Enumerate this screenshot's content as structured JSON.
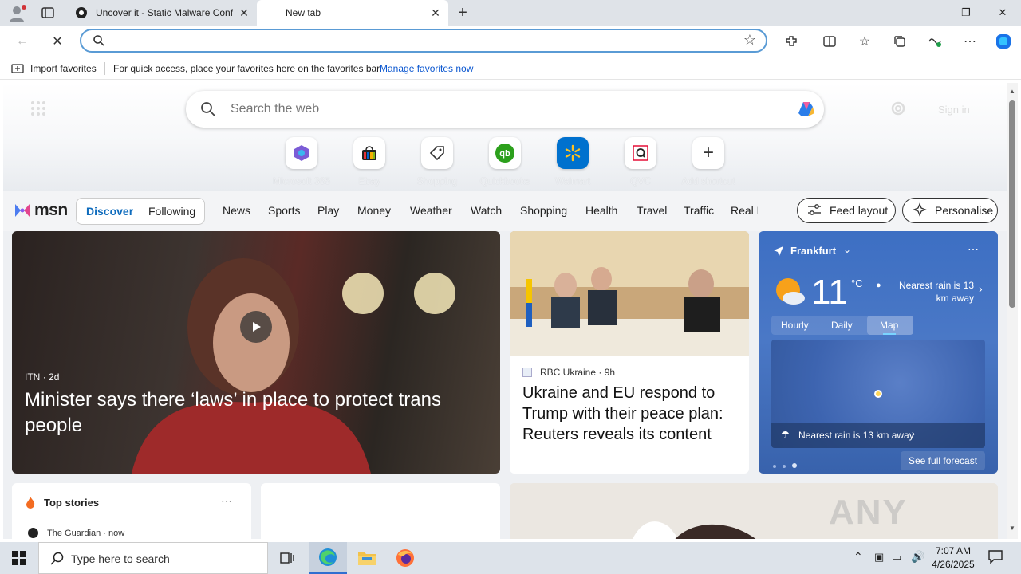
{
  "tabs": [
    {
      "title": "Uncover it - Static Malware Confi",
      "active": false
    },
    {
      "title": "New tab",
      "active": true
    }
  ],
  "window_controls": {
    "minimize": "—",
    "restore": "❐",
    "close": "✕"
  },
  "addressbar": {
    "value": "",
    "placeholder": ""
  },
  "favorites_bar": {
    "import_label": "Import favorites",
    "message": "For quick access, place your favorites here on the favorites bar.",
    "manage_link": "Manage favorites now"
  },
  "ntp": {
    "search_placeholder": "Search the web",
    "sign_in": "Sign in",
    "shortcuts": [
      {
        "label": "Microsoft 365",
        "icon": "m365-icon"
      },
      {
        "label": "Ebay",
        "icon": "ebay-icon"
      },
      {
        "label": "Shopping",
        "icon": "shopping-tag-icon"
      },
      {
        "label": "Quickbooks",
        "icon": "quickbooks-icon"
      },
      {
        "label": "Walmart",
        "icon": "walmart-icon"
      },
      {
        "label": "QVC",
        "icon": "qvc-icon"
      },
      {
        "label": "Add shortcut",
        "icon": "plus-icon"
      }
    ]
  },
  "msn": {
    "logo": "msn",
    "tabs": [
      "Discover",
      "Following"
    ],
    "nav": [
      "News",
      "Sports",
      "Play",
      "Money",
      "Weather",
      "Watch",
      "Shopping",
      "Health",
      "Travel",
      "Traffic",
      "Real E"
    ],
    "feed_layout": "Feed layout",
    "personalise": "Personalise"
  },
  "hero_story": {
    "source": "ITN",
    "age": "2d",
    "headline": "Minister says there ‘laws’ in place to protect trans people"
  },
  "second_story": {
    "source": "RBC Ukraine",
    "age": "9h",
    "headline": "Ukraine and EU respond to Trump with their peace plan: Reuters reveals its content"
  },
  "weather": {
    "location": "Frankfurt",
    "temp": "11",
    "unit": "°C",
    "rain_note": "Nearest rain is 13 km away",
    "tabs": [
      "Hourly",
      "Daily",
      "Map"
    ],
    "active_tab": "Map",
    "map_note": "Nearest rain is 13 km away",
    "see_full": "See full forecast"
  },
  "top_stories": {
    "title": "Top stories",
    "first_source": "The Guardian · now"
  },
  "watermark": "ANY RUN",
  "taskbar": {
    "search_placeholder": "Type here to search",
    "time": "7:07 AM",
    "date": "4/26/2025"
  }
}
